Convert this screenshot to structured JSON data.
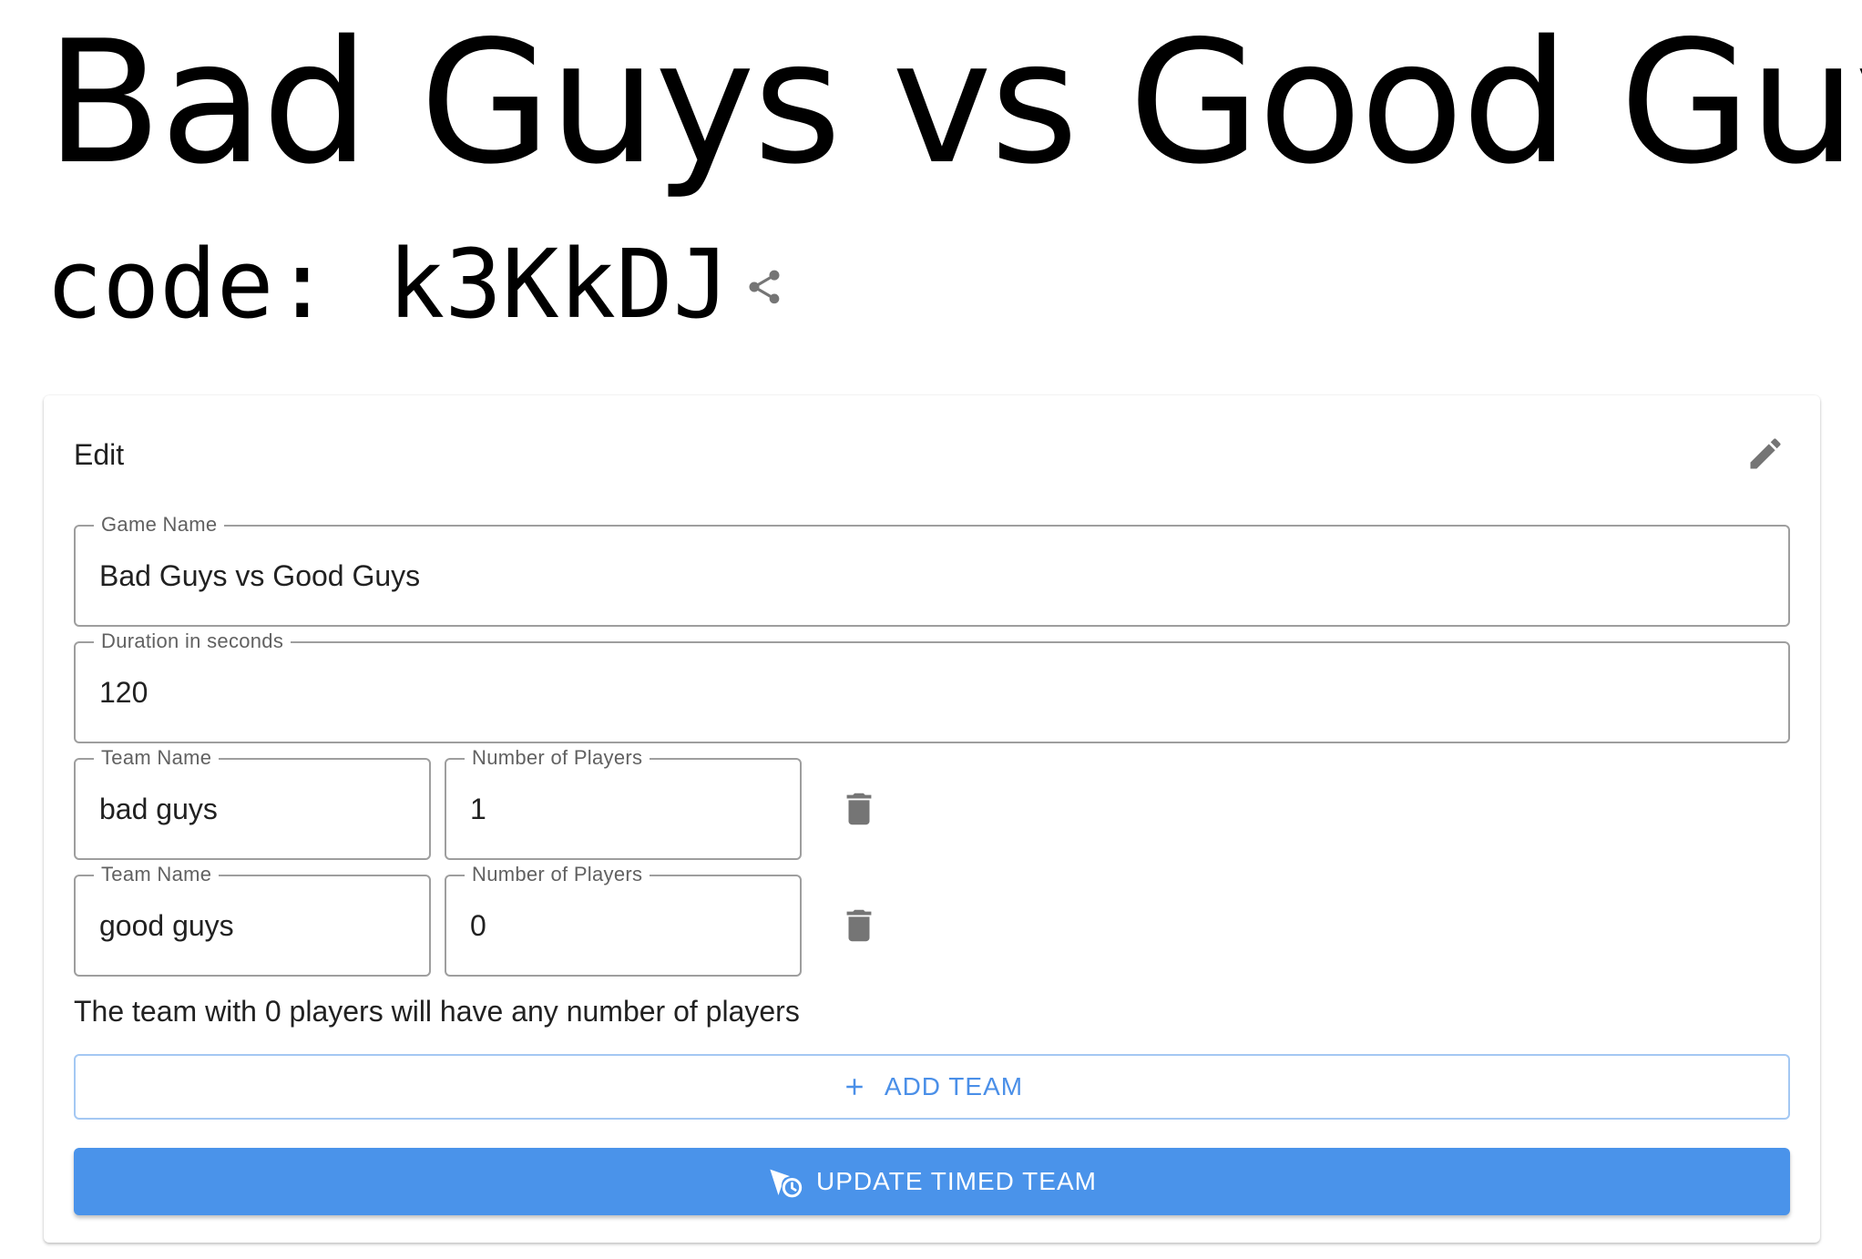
{
  "page": {
    "title": "Bad Guys vs Good Guys",
    "code_label": "code: k3KkDJ"
  },
  "card": {
    "header": "Edit",
    "game_name": {
      "label": "Game Name",
      "value": "Bad Guys vs Good Guys"
    },
    "duration": {
      "label": "Duration in seconds",
      "value": "120"
    },
    "teams": [
      {
        "name_label": "Team Name",
        "name_value": "bad guys",
        "players_label": "Number of Players",
        "players_value": "1"
      },
      {
        "name_label": "Team Name",
        "name_value": "good guys",
        "players_label": "Number of Players",
        "players_value": "0"
      }
    ],
    "hint": "The team with 0 players will have any number of players",
    "add_team_label": "ADD TEAM",
    "update_label": "UPDATE TIMED TEAM"
  },
  "icons": {
    "share": "share-icon",
    "edit": "pencil-icon",
    "delete": "trash-icon",
    "add": "plus-icon",
    "update": "timer-send-icon"
  },
  "colors": {
    "primary": "#4a93ea",
    "primary_text": "#4a8fe8",
    "outline": "#9e9e9e",
    "icon_grey": "#757575"
  }
}
